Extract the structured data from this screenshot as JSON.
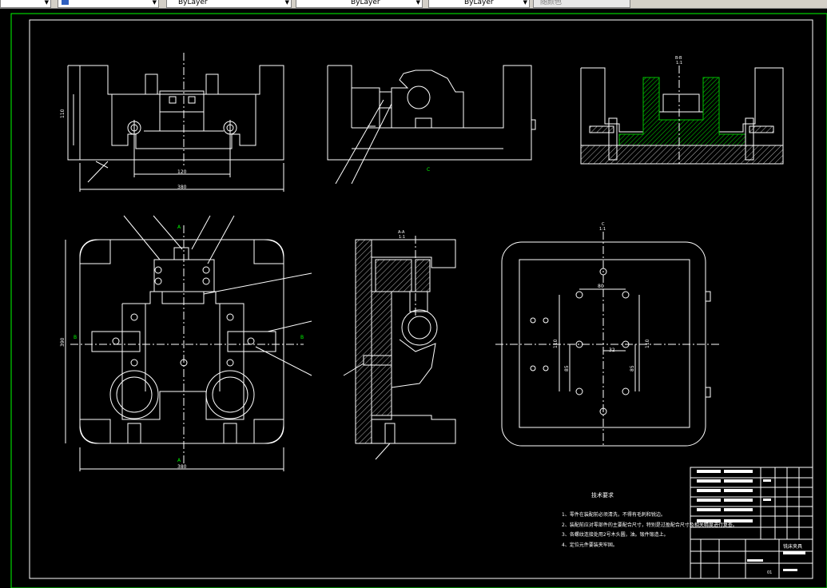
{
  "toolbar": {
    "layer_combo": "ByLayer",
    "linetype_combo": "ByLayer",
    "lineweight_combo": "ByLayer",
    "plotstyle_combo": "随颜色"
  },
  "drawing": {
    "dims": {
      "front_width": "380",
      "front_span": "120",
      "front_height": "110",
      "plan_width": "380",
      "plan_height": "390",
      "base_span_top": "80",
      "base_span_mid": "32",
      "base_height_l": "110",
      "base_height_r": "110",
      "base_inner_l": "85",
      "base_inner_r": "85"
    },
    "section_labels": {
      "side_view": "A-A",
      "side_scale": "1:1",
      "detail_view": "B-B",
      "detail_scale": "1:1",
      "base_view": "C",
      "base_scale": "1:1",
      "cut_a": "A",
      "cut_b": "B",
      "cut_c": "C"
    },
    "notes": {
      "title": "技术要求",
      "items": [
        "1、零件在装配前必须清洗，不得有毛刺和锐边。",
        "2、装配前应对零部件的主要配合尺寸，特别是过盈配合尺寸及相关精度进行复查。",
        "3、各螺纹连接处用2号木头圆，油。锻件锻造上。",
        "4、定位元件要装夹牢固。"
      ]
    },
    "title_block": {
      "part_name": "铣床夹具",
      "sheet_code": "01"
    }
  },
  "colors": {
    "line": "#ffffff",
    "hatch": "#00c000",
    "border": "#00ff00",
    "bg": "#000000"
  }
}
